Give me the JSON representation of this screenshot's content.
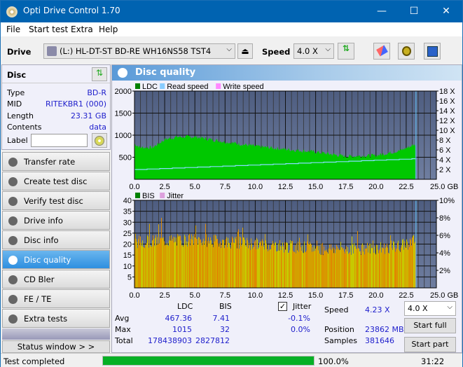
{
  "window": {
    "title": "Opti Drive Control 1.70",
    "minimize": "—",
    "maximize": "☐",
    "close": "✕"
  },
  "menu": [
    "File",
    "Start test",
    "Extra",
    "Help"
  ],
  "toolbar": {
    "drive_label": "Drive",
    "drive_value": "(L:)  HL-DT-ST BD-RE  WH16NS58 TST4",
    "speed_label": "Speed",
    "speed_value": "4.0 X"
  },
  "disc": {
    "title": "Disc",
    "rows": [
      {
        "k": "Type",
        "v": "BD-R"
      },
      {
        "k": "MID",
        "v": "RITEKBR1 (000)"
      },
      {
        "k": "Length",
        "v": "23.31 GB"
      },
      {
        "k": "Contents",
        "v": "data"
      }
    ],
    "label_field": "Label",
    "label_value": ""
  },
  "nav": [
    "Transfer rate",
    "Create test disc",
    "Verify test disc",
    "Drive info",
    "Disc info",
    "Disc quality",
    "CD Bler",
    "FE / TE",
    "Extra tests"
  ],
  "nav_active": "Disc quality",
  "status_window_btn": "Status window > >",
  "panel_title": "Disc quality",
  "chart_data": [
    {
      "type": "area",
      "legend": [
        "LDC",
        "Read speed",
        "Write speed"
      ],
      "legend_colors": [
        "#008000",
        "#88ccff",
        "#ff88ff"
      ],
      "x_ticks": [
        "0.0",
        "2.5",
        "5.0",
        "7.5",
        "10.0",
        "12.5",
        "15.0",
        "17.5",
        "20.0",
        "22.5",
        "25.0 GB"
      ],
      "y_ticks": [
        "500",
        "1000",
        "1500",
        "2000"
      ],
      "y2_ticks": [
        "2 X",
        "4 X",
        "6 X",
        "8 X",
        "10 X",
        "12 X",
        "14 X",
        "16 X",
        "18 X"
      ],
      "xlim": [
        0,
        25
      ],
      "ylim": [
        0,
        2000
      ],
      "y2lim": [
        0,
        18
      ],
      "ldc_profile": [
        [
          0,
          800
        ],
        [
          0.5,
          720
        ],
        [
          1.5,
          720
        ],
        [
          2.5,
          900
        ],
        [
          3.5,
          960
        ],
        [
          5,
          960
        ],
        [
          7.5,
          850
        ],
        [
          10,
          750
        ],
        [
          12.5,
          680
        ],
        [
          15,
          620
        ],
        [
          17.5,
          520
        ],
        [
          20,
          540
        ],
        [
          22,
          650
        ],
        [
          23.3,
          800
        ]
      ],
      "read_speed": [
        [
          0,
          2
        ],
        [
          23.3,
          4.23
        ]
      ],
      "end_marker": 23.31
    },
    {
      "type": "bar",
      "legend": [
        "BIS",
        "Jitter"
      ],
      "legend_colors": [
        "#008000",
        "#dda0dd"
      ],
      "x_ticks": [
        "0.0",
        "2.5",
        "5.0",
        "7.5",
        "10.0",
        "12.5",
        "15.0",
        "17.5",
        "20.0",
        "22.5",
        "25.0 GB"
      ],
      "y_ticks": [
        "5",
        "10",
        "15",
        "20",
        "25",
        "30",
        "35",
        "40"
      ],
      "y2_ticks": [
        "2%",
        "4%",
        "6%",
        "8%",
        "10%"
      ],
      "xlim": [
        0,
        25
      ],
      "ylim": [
        0,
        40
      ],
      "y2lim": [
        0,
        10
      ],
      "bis_profile": [
        [
          0,
          21
        ],
        [
          5,
          22
        ],
        [
          10,
          20
        ],
        [
          15,
          18
        ],
        [
          20,
          18
        ],
        [
          22,
          19
        ],
        [
          23.3,
          22
        ]
      ],
      "bis_max": 32,
      "end_marker": 23.31
    }
  ],
  "stats": {
    "col_ldc": "LDC",
    "col_bis": "BIS",
    "jitter_label": "Jitter",
    "jitter_checked": true,
    "rows": [
      {
        "k": "Avg",
        "ldc": "467.36",
        "bis": "7.41",
        "jit": "-0.1%"
      },
      {
        "k": "Max",
        "ldc": "1015",
        "bis": "32",
        "jit": "0.0%"
      },
      {
        "k": "Total",
        "ldc": "178438903",
        "bis": "2827812",
        "jit": ""
      }
    ],
    "speed_label": "Speed",
    "speed_value": "4.23 X",
    "position_label": "Position",
    "position_value": "23862 MB",
    "samples_label": "Samples",
    "samples_value": "381646",
    "speed_select": "4.0 X",
    "start_full": "Start full",
    "start_part": "Start part"
  },
  "status": {
    "text": "Test completed",
    "progress_pct": 100,
    "progress_label": "100.0%",
    "time": "31:22"
  }
}
